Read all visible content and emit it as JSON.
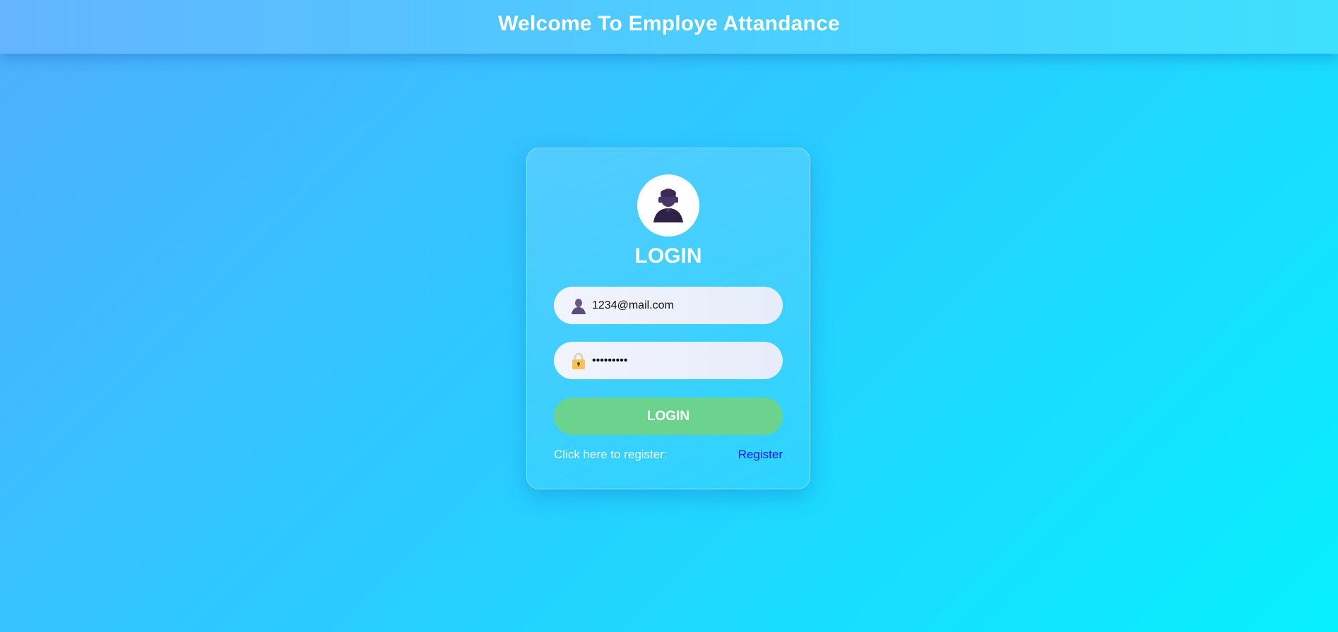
{
  "header": {
    "title": "Welcome To Employe Attandance"
  },
  "login_card": {
    "avatar_icon": "user-avatar-icon",
    "title": "LOGIN",
    "email": {
      "icon": "user-icon",
      "value": "1234@mail.com",
      "placeholder": ""
    },
    "password": {
      "icon": "lock-icon",
      "value": "123456789",
      "masked_display": "•••••••••"
    },
    "login_button_label": "LOGIN",
    "register_prompt": "Click here to register:",
    "register_link_label": "Register"
  },
  "colors": {
    "background_start": "#4faeff",
    "background_end": "#06f0fe",
    "login_button": "#6bd38e",
    "register_link": "#1a1ae8",
    "avatar_figure": "#3f2d5c"
  }
}
